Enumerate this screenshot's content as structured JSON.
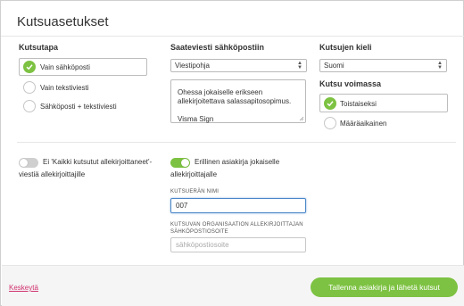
{
  "dialog": {
    "title": "Kutsuasetukset"
  },
  "colors": {
    "accent": "#7dc242",
    "link": "#d0306d",
    "focus": "#4a86c8"
  },
  "method": {
    "heading": "Kutsutapa",
    "options": [
      {
        "label": "Vain sähköposti",
        "selected": true
      },
      {
        "label": "Vain tekstiviesti",
        "selected": false
      },
      {
        "label": "Sähköposti + tekstiviesti",
        "selected": false
      }
    ]
  },
  "cover_email": {
    "heading": "Saateviesti sähköpostiin",
    "template_select": "Viestipohja",
    "message_line1": "Ohessa jokaiselle erikseen",
    "message_line2": "allekirjoitettava salassapitosopimus.",
    "message_line3": "Visma Sign"
  },
  "language": {
    "heading": "Kutsujen kieli",
    "selected": "Suomi"
  },
  "validity": {
    "heading": "Kutsu voimassa",
    "options": [
      {
        "label": "Toistaiseksi",
        "selected": true
      },
      {
        "label": "Määräaikainen",
        "selected": false
      }
    ]
  },
  "toggles": {
    "all_invited_line1": "Ei 'Kaikki kutsutut allekirjoittaneet'-",
    "all_invited_line2": "viestiä allekirjoittajille",
    "all_invited_on": false,
    "separate_line1": "Erillinen asiakirja jokaiselle",
    "separate_line2": "allekirjoittajalle",
    "separate_on": true
  },
  "batch": {
    "name_label": "KUTSUERÄN NIMI",
    "name_value": "007",
    "org_email_label_line1": "KUTSUVAN ORGANISAATION ALLEKIRJOITTAJAN",
    "org_email_label_line2": "SÄHKÖPOSTIOSOITE",
    "org_email_placeholder": "sähköpostiosoite"
  },
  "footer": {
    "cancel": "Keskeytä",
    "submit": "Tallenna asiakirja ja lähetä kutsut"
  }
}
